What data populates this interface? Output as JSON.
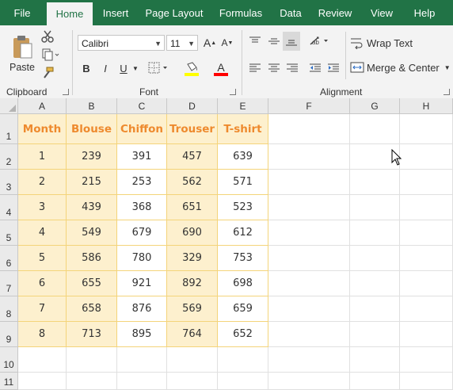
{
  "tabs": [
    {
      "label": "File"
    },
    {
      "label": "Home"
    },
    {
      "label": "Insert"
    },
    {
      "label": "Page Layout"
    },
    {
      "label": "Formulas"
    },
    {
      "label": "Data"
    },
    {
      "label": "Review"
    },
    {
      "label": "View"
    },
    {
      "label": "Help"
    }
  ],
  "active_tab": "Home",
  "ribbon": {
    "clipboard": {
      "paste_label": "Paste",
      "group_label": "Clipboard"
    },
    "font": {
      "font_name": "Calibri",
      "font_size": "11",
      "group_label": "Font",
      "bold": "B",
      "italic": "I",
      "underline": "U",
      "font_color_glyph": "A"
    },
    "alignment": {
      "wrap_text": "Wrap Text",
      "merge_center": "Merge & Center",
      "group_label": "Alignment"
    },
    "colors": {
      "accent": "#217346",
      "fill_yellow": "#ffff00",
      "font_red": "#ff0000"
    }
  },
  "sheet": {
    "columns": [
      "A",
      "B",
      "C",
      "D",
      "E",
      "F",
      "G",
      "H"
    ],
    "rows": [
      "1",
      "2",
      "3",
      "4",
      "5",
      "6",
      "7",
      "8",
      "9",
      "10",
      "11"
    ],
    "headers": [
      "Month",
      "Blouse",
      "Chiffon",
      "Trouser",
      "T-shirt"
    ],
    "data": [
      [
        "1",
        "239",
        "391",
        "457",
        "639"
      ],
      [
        "2",
        "215",
        "253",
        "562",
        "571"
      ],
      [
        "3",
        "439",
        "368",
        "651",
        "523"
      ],
      [
        "4",
        "549",
        "679",
        "690",
        "612"
      ],
      [
        "5",
        "586",
        "780",
        "329",
        "753"
      ],
      [
        "6",
        "655",
        "921",
        "892",
        "698"
      ],
      [
        "7",
        "658",
        "876",
        "569",
        "659"
      ],
      [
        "8",
        "713",
        "895",
        "764",
        "652"
      ]
    ],
    "colors": {
      "header_text": "#ee8a2e",
      "band_fill": "#fdf0ce",
      "border": "#f4d47a"
    }
  }
}
